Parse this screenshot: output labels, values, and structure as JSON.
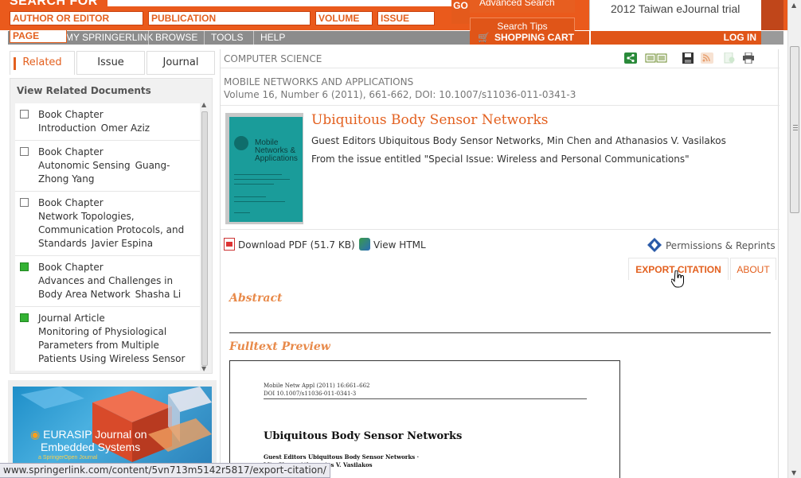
{
  "header": {
    "search_for": "SEARCH FOR",
    "fields": [
      "AUTHOR OR EDITOR",
      "PUBLICATION",
      "VOLUME",
      "ISSUE"
    ],
    "go_label": "GO",
    "advanced_search": "Advanced Search",
    "search_tips": "Search Tips",
    "trial_text": "2012 Taiwan eJournal trial"
  },
  "nav": {
    "page_field": "PAGE",
    "items": [
      "MY SPRINGERLINK",
      "BROWSE",
      "TOOLS",
      "HELP"
    ],
    "cart": "SHOPPING CART",
    "login": "LOG IN"
  },
  "sidebar": {
    "tabs": [
      "Related",
      "Issue",
      "Journal"
    ],
    "active_tab": "Related",
    "panel_title": "View Related Documents",
    "related": [
      {
        "type": "Book Chapter",
        "title": "Introduction",
        "author": "Omer Aziz",
        "checked": false
      },
      {
        "type": "Book Chapter",
        "title": "Autonomic Sensing",
        "author": "Guang-Zhong Yang",
        "checked": false
      },
      {
        "type": "Book Chapter",
        "title": "Network Topologies, Communication Protocols, and Standards",
        "author": "Javier Espina",
        "checked": false
      },
      {
        "type": "Book Chapter",
        "title": "Advances and Challenges in Body Area Network",
        "author": "Shasha Li",
        "checked": true
      },
      {
        "type": "Journal Article",
        "title": "Monitoring of Physiological Parameters from Multiple Patients Using Wireless Sensor",
        "author": "",
        "checked": true
      }
    ],
    "ad": {
      "title_line1": "EURASIP Journal on",
      "title_line2": "Embedded Systems",
      "subtitle": "a SpringerOpen Journal"
    }
  },
  "main": {
    "subject": "COMPUTER SCIENCE",
    "journal": "MOBILE NETWORKS AND APPLICATIONS",
    "citation": "Volume 16, Number 6 (2011), 661-662, DOI: 10.1007/s11036-011-0341-3",
    "cover_title": "Mobile Networks & Applications",
    "title": "Ubiquitous Body Sensor Networks",
    "guest_editors": "Guest Editors Ubiquitous Body Sensor Networks, Min Chen and Athanasios V. Vasilakos",
    "from_issue": "From the issue entitled \"Special Issue: Wireless and Personal Communications\"",
    "download_pdf": "Download PDF (51.7 KB)",
    "view_html": "View HTML",
    "permissions": "Permissions & Reprints",
    "export_citation": "EXPORT CITATION",
    "about": "ABOUT",
    "abstract_heading": "Abstract",
    "fulltext_heading": "Fulltext Preview",
    "preview": {
      "header_line1": "Mobile Netw Appl (2011) 16:661–662",
      "header_line2": "DOI 10.1007/s11036-011-0341-3",
      "title": "Ubiquitous Body Sensor Networks",
      "ge_line1": "Guest Editors Ubiquitous Body Sensor Networks ·",
      "ge_line2": "Min Chen · Athanasios V. Vasilakos"
    }
  },
  "status_bar": "www.springerlink.com/content/5vn713m5142r5817/export-citation/",
  "colors": {
    "brand_orange": "#ea5a1c",
    "nav_gray": "#8c8c8c",
    "link_orange": "#e3601f",
    "cover_teal": "#1a9c9a",
    "checked_green": "#33b233"
  }
}
